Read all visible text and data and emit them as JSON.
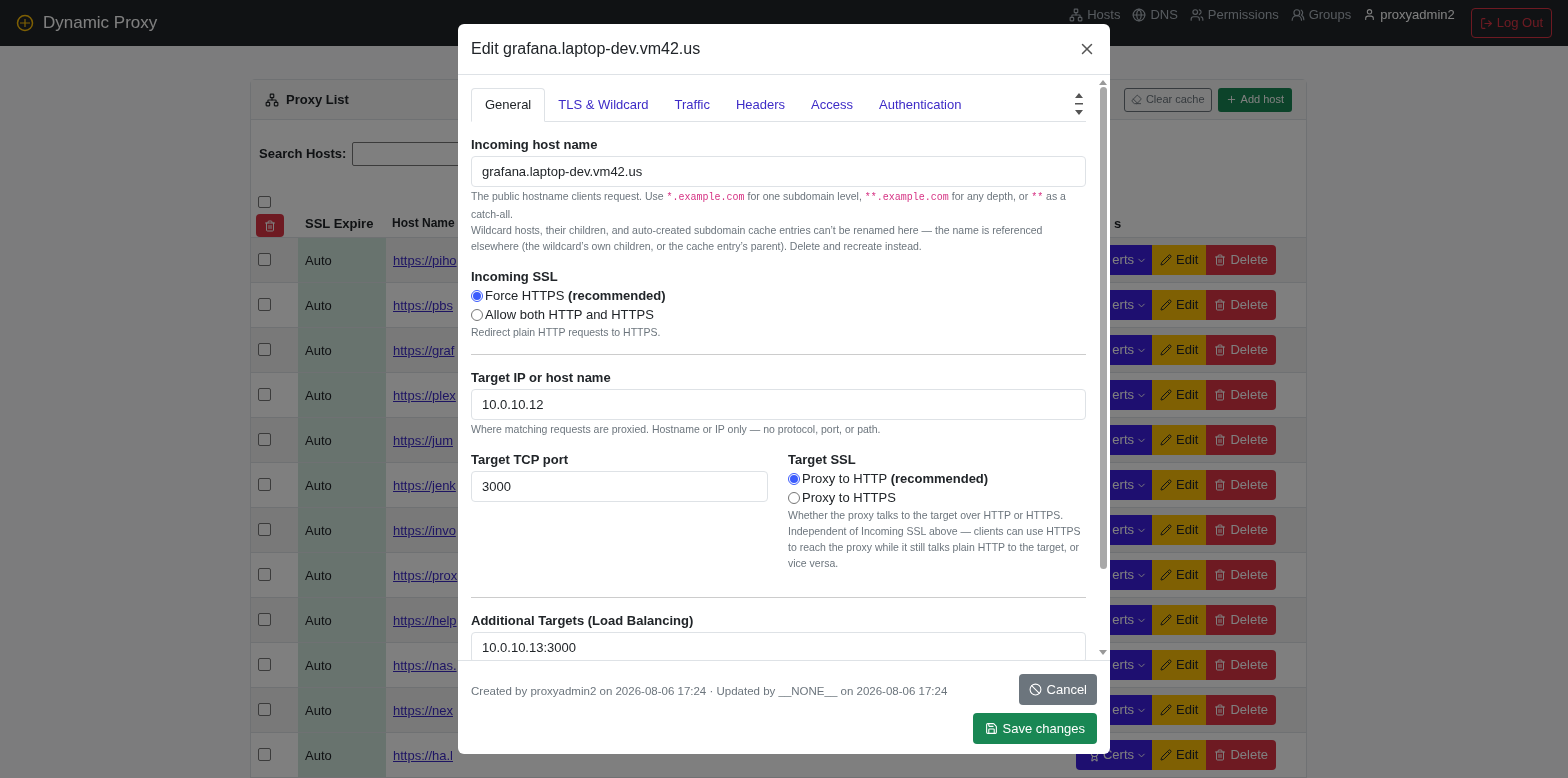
{
  "navbar": {
    "brand": "Dynamic Proxy",
    "items": [
      {
        "kind": "hosts",
        "label": "Hosts"
      },
      {
        "kind": "dns",
        "label": "DNS"
      },
      {
        "kind": "permissions",
        "label": "Permissions"
      },
      {
        "kind": "groups",
        "label": "Groups"
      }
    ],
    "user": "proxyadmin2",
    "logout": "Log Out"
  },
  "proxy_list": {
    "title": "Proxy List",
    "clear_cache": "Clear cache",
    "add_host": "Add host",
    "search_label": "Search Hosts:",
    "select_all_checked": false,
    "columns": [
      "SSL Expire",
      "Host Name",
      "s"
    ],
    "rows": [
      {
        "ssl": "Auto",
        "host": "https://piho",
        "certs": "erts",
        "edit": "Edit",
        "delete": "Delete",
        "checked": false
      },
      {
        "ssl": "Auto",
        "host": "https://pbs",
        "certs": "erts",
        "edit": "Edit",
        "delete": "Delete",
        "checked": false
      },
      {
        "ssl": "Auto",
        "host": "https://graf",
        "certs": "erts",
        "edit": "Edit",
        "delete": "Delete",
        "checked": false
      },
      {
        "ssl": "Auto",
        "host": "https://plex",
        "certs": "erts",
        "edit": "Edit",
        "delete": "Delete",
        "checked": false
      },
      {
        "ssl": "Auto",
        "host": "https://jum",
        "certs": "erts",
        "edit": "Edit",
        "delete": "Delete",
        "checked": false
      },
      {
        "ssl": "Auto",
        "host": "https://jenk",
        "certs": "erts",
        "edit": "Edit",
        "delete": "Delete",
        "checked": false
      },
      {
        "ssl": "Auto",
        "host": "https://invo",
        "certs": "erts",
        "edit": "Edit",
        "delete": "Delete",
        "checked": false
      },
      {
        "ssl": "Auto",
        "host": "https://prox",
        "certs": "erts",
        "edit": "Edit",
        "delete": "Delete",
        "checked": false
      },
      {
        "ssl": "Auto",
        "host": "https://help",
        "certs": "erts",
        "edit": "Edit",
        "delete": "Delete",
        "checked": false
      },
      {
        "ssl": "Auto",
        "host": "https://nas.",
        "certs": "erts",
        "edit": "Edit",
        "delete": "Delete",
        "checked": false
      },
      {
        "ssl": "Auto",
        "host": "https://nex",
        "certs": "erts",
        "edit": "Edit",
        "delete": "Delete",
        "checked": false
      },
      {
        "ssl": "Auto",
        "host": "https://ha.l",
        "certs": "Certs",
        "edit": "Edit",
        "delete": "Delete",
        "checked": false
      }
    ]
  },
  "modal": {
    "title": "Edit grafana.laptop-dev.vm42.us",
    "tabs": [
      {
        "label": "General",
        "selected": true
      },
      {
        "label": "TLS & Wildcard",
        "selected": false
      },
      {
        "label": "Traffic",
        "selected": false
      },
      {
        "label": "Headers",
        "selected": false
      },
      {
        "label": "Access",
        "selected": false
      },
      {
        "label": "Authentication",
        "selected": false
      }
    ],
    "incoming_host": {
      "label": "Incoming host name",
      "value": "grafana.laptop-dev.vm42.us",
      "help": [
        {
          "kind": "text",
          "text": "The public hostname clients request. Use "
        },
        {
          "kind": "code",
          "text": "*.example.com"
        },
        {
          "kind": "text",
          "text": " for one subdomain level, "
        },
        {
          "kind": "code",
          "text": "**.example.com"
        },
        {
          "kind": "text",
          "text": " for any depth, or "
        },
        {
          "kind": "code",
          "text": "**"
        },
        {
          "kind": "text",
          "text": " as a catch-all."
        }
      ],
      "note": "Wildcard hosts, their children, and auto-created subdomain cache entries can’t be renamed here — the name is referenced elsewhere (the wildcard’s own children, or the cache entry’s parent). Delete and recreate instead."
    },
    "incoming_ssl": {
      "label": "Incoming SSL",
      "options": [
        {
          "label": "Force HTTPS **(recommended)**",
          "selected": true
        },
        {
          "label": "Allow both HTTP and HTTPS",
          "selected": false
        }
      ],
      "help": "Redirect plain HTTP requests to HTTPS."
    },
    "target_host": {
      "label": "Target IP or host name",
      "value": "10.0.10.12",
      "help": "Where matching requests are proxied. Hostname or IP only — no protocol, port, or path."
    },
    "target_port": {
      "label": "Target TCP port",
      "value": "3000"
    },
    "target_ssl": {
      "label": "Target SSL",
      "options": [
        {
          "label": "Proxy to HTTP **(recommended)**",
          "selected": true
        },
        {
          "label": "Proxy to HTTPS",
          "selected": false
        }
      ],
      "help": "Whether the proxy talks to the target over HTTP or HTTPS. Independent of Incoming SSL above — clients can use HTTPS to reach the proxy while it still talks plain HTTP to the target, or vice versa."
    },
    "additional_targets": {
      "label": "Additional Targets (Load Balancing)",
      "value": "10.0.10.13:3000"
    },
    "footer_text": "Created by proxyadmin2 on 2026-08-06 17:24 · Updated by __NONE__ on 2026-08-06 17:24",
    "cancel": "Cancel",
    "save": "Save changes"
  }
}
